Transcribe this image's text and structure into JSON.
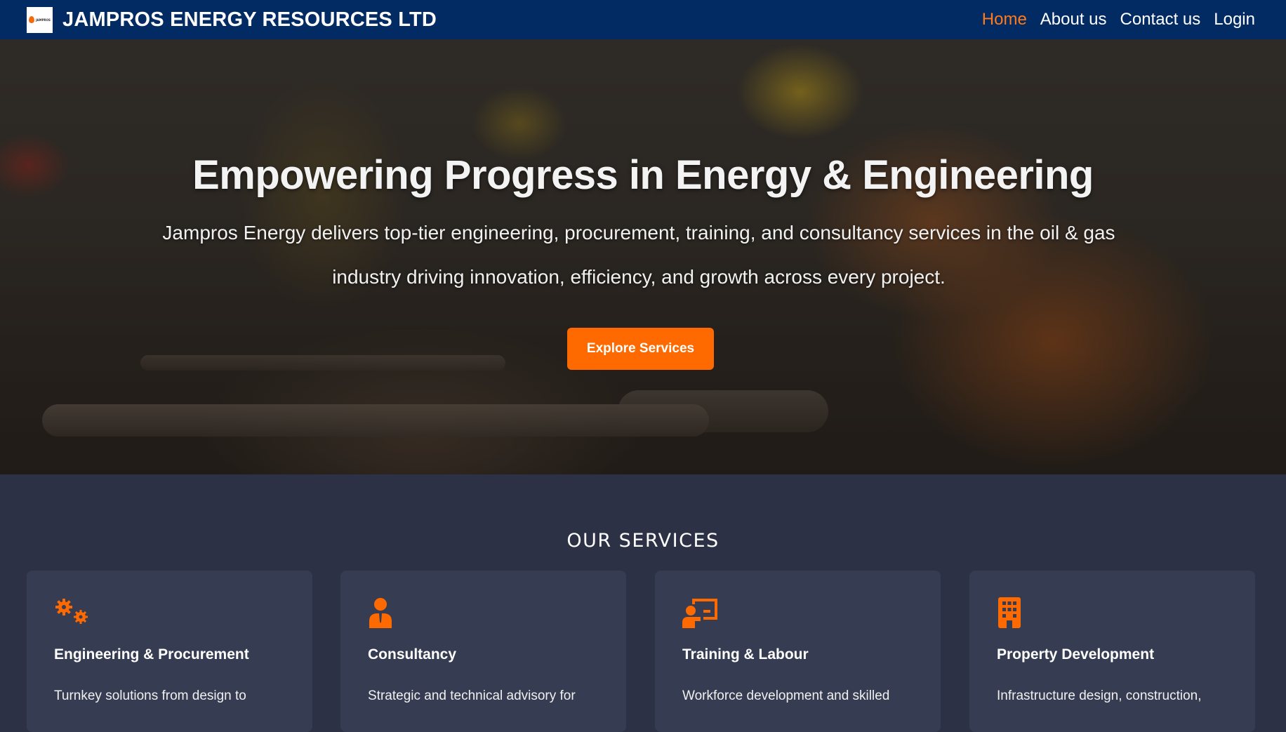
{
  "navbar": {
    "brand_name": "JAMPROS ENERGY RESOURCES LTD",
    "logo_text": "JAMPROS",
    "links": [
      {
        "label": "Home",
        "active": true
      },
      {
        "label": "About us",
        "active": false
      },
      {
        "label": "Contact us",
        "active": false
      },
      {
        "label": "Login",
        "active": false
      }
    ]
  },
  "hero": {
    "title": "Empowering Progress in Energy & Engineering",
    "subtitle": "Jampros Energy delivers top-tier engineering, procurement, training, and consultancy services in the oil & gas industry driving innovation, efficiency, and growth across every project.",
    "cta_label": "Explore Services"
  },
  "services": {
    "heading": "OUR SERVICES",
    "cards": [
      {
        "icon": "gears-icon",
        "title": "Engineering & Procurement",
        "description": "Turnkey solutions from design to"
      },
      {
        "icon": "consultant-icon",
        "title": "Consultancy",
        "description": "Strategic and technical advisory for"
      },
      {
        "icon": "training-icon",
        "title": "Training & Labour",
        "description": "Workforce development and skilled"
      },
      {
        "icon": "building-icon",
        "title": "Property Development",
        "description": "Infrastructure design, construction,"
      }
    ]
  },
  "colors": {
    "navbar_bg": "#032b63",
    "accent": "#ff6a00",
    "active_link": "#ff7a1a",
    "section_bg": "#2c3146",
    "card_bg": "#363c52"
  }
}
